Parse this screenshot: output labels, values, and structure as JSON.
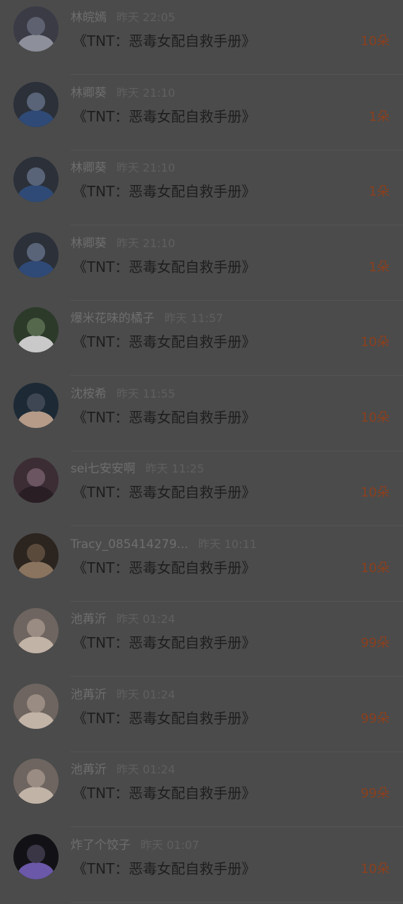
{
  "gift_records": [
    {
      "name": "林皖嫣",
      "time": "昨天 22:05",
      "title": "《TNT：恶毒女配自救手册》",
      "amount": "10朵",
      "avatar": "avatar-dark-cloth",
      "avatar_colors": [
        "#3a3b45",
        "#5d6170",
        "#8d8f9a"
      ]
    },
    {
      "name": "林卿葵",
      "time": "昨天 21:10",
      "title": "《TNT：恶毒女配自救手册》",
      "amount": "1朵",
      "avatar": "avatar-boy-blue",
      "avatar_colors": [
        "#2b3039",
        "#5a6478",
        "#2f4a76"
      ]
    },
    {
      "name": "林卿葵",
      "time": "昨天 21:10",
      "title": "《TNT：恶毒女配自救手册》",
      "amount": "1朵",
      "avatar": "avatar-boy-blue",
      "avatar_colors": [
        "#2b3039",
        "#5a6478",
        "#2f4a76"
      ]
    },
    {
      "name": "林卿葵",
      "time": "昨天 21:10",
      "title": "《TNT：恶毒女配自救手册》",
      "amount": "1朵",
      "avatar": "avatar-boy-blue",
      "avatar_colors": [
        "#2b3039",
        "#5a6478",
        "#2f4a76"
      ]
    },
    {
      "name": "爆米花味的橘子",
      "time": "昨天 11:57",
      "title": "《TNT：恶毒女配自救手册》",
      "amount": "10朵",
      "avatar": "avatar-girl-field",
      "avatar_colors": [
        "#2c3a2a",
        "#55684c",
        "#c9c9c9"
      ]
    },
    {
      "name": "沈桉希",
      "time": "昨天 11:55",
      "title": "《TNT：恶毒女配自救手册》",
      "amount": "10朵",
      "avatar": "avatar-girl-dark",
      "avatar_colors": [
        "#1d2a36",
        "#3d4652",
        "#b59b88"
      ]
    },
    {
      "name": "sei七安安啊",
      "time": "昨天 11:25",
      "title": "《TNT：恶毒女配自救手册》",
      "amount": "10朵",
      "avatar": "avatar-roses",
      "avatar_colors": [
        "#3c2d34",
        "#6a5560",
        "#2a1e25"
      ]
    },
    {
      "name": "Tracy_085414279...",
      "time": "昨天 10:11",
      "title": "《TNT：恶毒女配自救手册》",
      "amount": "10朵",
      "avatar": "avatar-boy-brown",
      "avatar_colors": [
        "#2b241f",
        "#5a4a3c",
        "#8a745f"
      ]
    },
    {
      "name": "池苒沂",
      "time": "昨天 01:24",
      "title": "《TNT：恶毒女配自救手册》",
      "amount": "99朵",
      "avatar": "avatar-girl-light",
      "avatar_colors": [
        "#6e6560",
        "#9a8c82",
        "#c2b3a7"
      ]
    },
    {
      "name": "池苒沂",
      "time": "昨天 01:24",
      "title": "《TNT：恶毒女配自救手册》",
      "amount": "99朵",
      "avatar": "avatar-girl-light",
      "avatar_colors": [
        "#6e6560",
        "#9a8c82",
        "#c2b3a7"
      ]
    },
    {
      "name": "池苒沂",
      "time": "昨天 01:24",
      "title": "《TNT：恶毒女配自救手册》",
      "amount": "99朵",
      "avatar": "avatar-girl-light",
      "avatar_colors": [
        "#6e6560",
        "#9a8c82",
        "#c2b3a7"
      ]
    },
    {
      "name": "炸了个饺子",
      "time": "昨天 01:07",
      "title": "《TNT：恶毒女配自救手册》",
      "amount": "10朵",
      "avatar": "avatar-boy-purple",
      "avatar_colors": [
        "#121216",
        "#3a3646",
        "#6b58a8"
      ]
    }
  ]
}
